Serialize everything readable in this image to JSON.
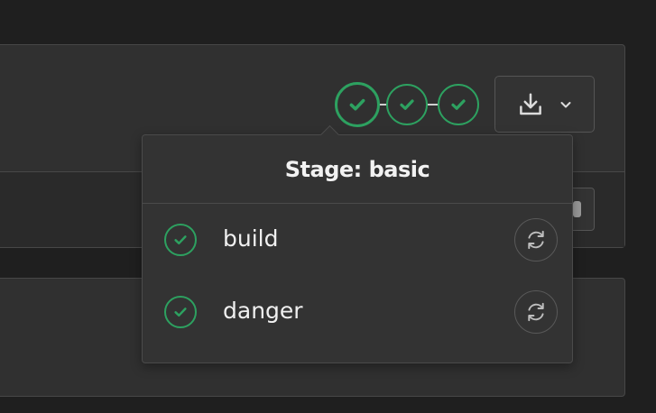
{
  "pipeline": {
    "stages": [
      {
        "status": "success",
        "icon": "check-circle-icon"
      },
      {
        "status": "success",
        "icon": "check-circle-icon"
      },
      {
        "status": "success",
        "icon": "check-circle-icon"
      }
    ]
  },
  "download_button": {
    "icon": "download-icon",
    "caret_icon": "chevron-down-icon"
  },
  "dropdown": {
    "title": "Stage: basic",
    "jobs": [
      {
        "name": "build",
        "status": "success",
        "action_icon": "retry-icon"
      },
      {
        "name": "danger",
        "status": "success",
        "action_icon": "retry-icon"
      }
    ]
  },
  "colors": {
    "background": "#1f1f1f",
    "card": "#303030",
    "success": "#2da160",
    "text": "#ededed"
  }
}
